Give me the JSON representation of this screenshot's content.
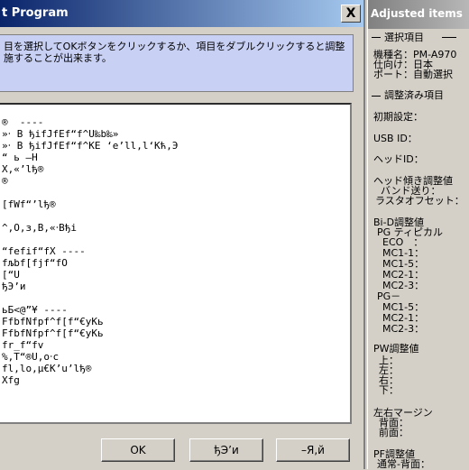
{
  "dialog": {
    "title": "t Program",
    "close_glyph": "X",
    "instruction_line1": "目を選択してOKボタンをクリックするか、項目をダブルクリックすると調整",
    "instruction_line2": "施することが出来ます。",
    "list_lines": [
      "",
      "®  ----",
      "»‧ B ђifJfEf“f^U‰b‰»",
      "»‧ B ђifJfEf“f^KE ‘e’ll,l‘Kћ,Э",
      "“ ь –H",
      "X,«’lђ®",
      "®",
      "",
      "[fWf“’lђ®",
      "",
      "^,O,з,B,«‧Bђi",
      "",
      "“fefif“fX ----",
      "fљbf[fjf“fO",
      "[“U",
      "ђЭ’и",
      "",
      "ьБ<@”¥ ----",
      "FfbfNfpf^f[f“€уКь",
      "FfbfNfpf^f[f“€уКь",
      "fr_f“fv",
      "%‚T“®U,o‧c",
      "fl,lo,µ€K’u’lђ®",
      "Xfg"
    ],
    "buttons": {
      "ok": "OK",
      "second": "ђЭ’и",
      "third": "–Я,й"
    }
  },
  "panel": {
    "title": "Adjusted items",
    "section_selected": "選択項目",
    "model_label": "機種名：PM-A970",
    "destination_label": "仕向け：日本",
    "port_label": "ポート：自動選択",
    "section_adjusted": "調整済み項目",
    "initial_setting": "初期設定：",
    "usb_id": "USB ID：",
    "head_id": "ヘッドID：",
    "head_tilt": "ヘッド傾き調整値",
    "band_feed": "バンド送り：",
    "raster_offset": "ラスタオフセット：",
    "bid_adjust": "Bi-D調整値",
    "pg_tyical": "PG ティピカル",
    "eco": "ECO　：",
    "mc1_1": "MC1-1：",
    "mc1_5": "MC1-5：",
    "mc2_1": "MC2-1：",
    "mc2_3": "MC2-3：",
    "pg_minus": "PG－",
    "mc1_5b": "MC1-5：",
    "mc2_1b": "MC2-1：",
    "mc2_3b": "MC2-3：",
    "pw_adjust": "PW調整値",
    "pw_up": "上：",
    "pw_left": "左：",
    "pw_right": "右：",
    "pw_down": "下：",
    "margin": "左右マージン",
    "margin_back": "背面：",
    "margin_front": "前面：",
    "pf_adjust": "PF調整値",
    "pf_normal": "通常-背面："
  }
}
